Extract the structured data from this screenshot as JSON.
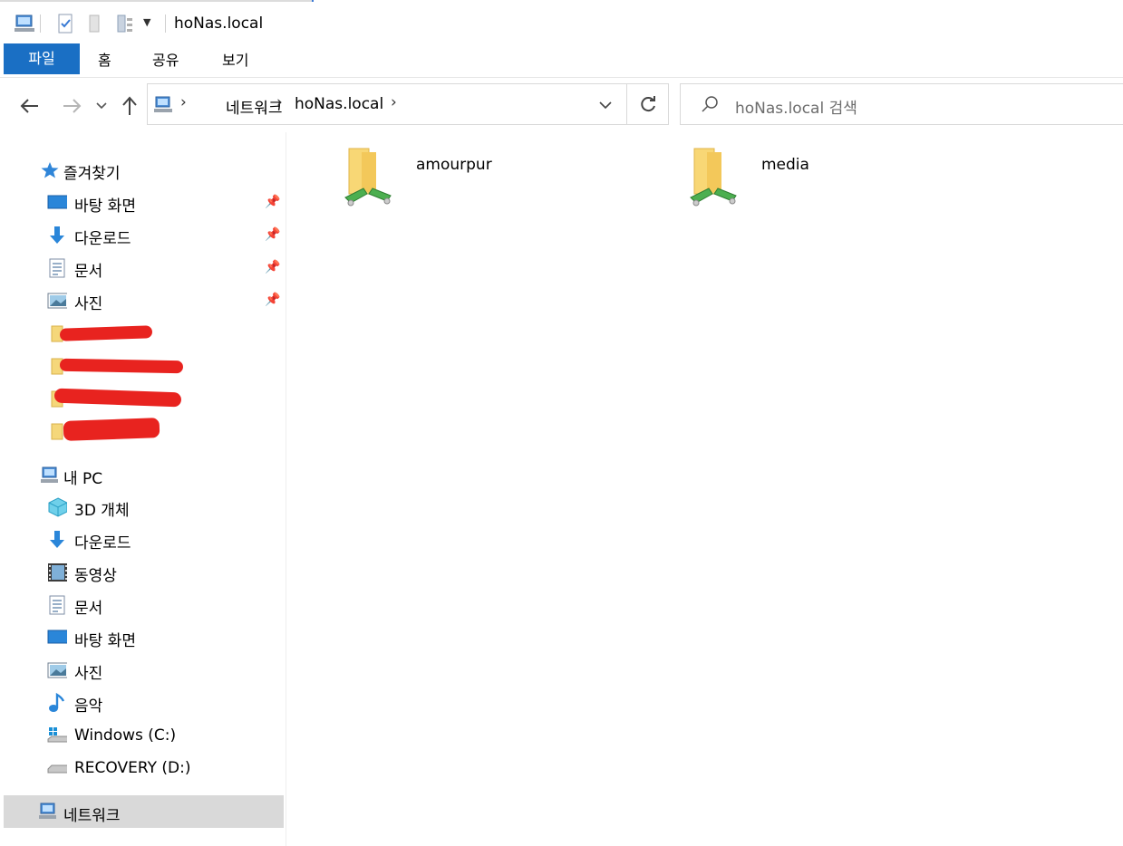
{
  "window": {
    "title": "hoNas.local"
  },
  "ribbon": {
    "tabs": [
      {
        "label": "파일",
        "active": true
      },
      {
        "label": "홈"
      },
      {
        "label": "공유"
      },
      {
        "label": "보기"
      }
    ]
  },
  "address": {
    "crumbs": [
      "네트워크",
      "hoNas.local"
    ]
  },
  "search": {
    "placeholder": "hoNas.local 검색"
  },
  "nav": {
    "quick_access": {
      "label": "즐겨찾기"
    },
    "quick_items": [
      {
        "label": "바탕 화면",
        "icon": "desktop-icon",
        "pinned": true
      },
      {
        "label": "다운로드",
        "icon": "download-arrow-icon",
        "pinned": true
      },
      {
        "label": "문서",
        "icon": "document-icon",
        "pinned": true
      },
      {
        "label": "사진",
        "icon": "picture-icon",
        "pinned": true
      }
    ],
    "this_pc": {
      "label": "내 PC"
    },
    "pc_items": [
      {
        "label": "3D 개체",
        "icon": "3d-cube-icon"
      },
      {
        "label": "다운로드",
        "icon": "download-arrow-icon"
      },
      {
        "label": "동영상",
        "icon": "video-icon"
      },
      {
        "label": "문서",
        "icon": "document-icon"
      },
      {
        "label": "바탕 화면",
        "icon": "desktop-icon"
      },
      {
        "label": "사진",
        "icon": "picture-icon"
      },
      {
        "label": "음악",
        "icon": "music-note-icon"
      },
      {
        "label": "Windows (C:)",
        "icon": "windows-drive-icon"
      },
      {
        "label": "RECOVERY (D:)",
        "icon": "drive-icon"
      }
    ],
    "network": {
      "label": "네트워크",
      "selected": true
    }
  },
  "content": {
    "items": [
      {
        "label": "amourpur",
        "icon": "network-folder-icon"
      },
      {
        "label": "media",
        "icon": "network-folder-icon"
      }
    ]
  },
  "colors": {
    "accent": "#1a6fc4",
    "selected_bg": "#d9d9d9",
    "redaction": "#e8231f"
  }
}
